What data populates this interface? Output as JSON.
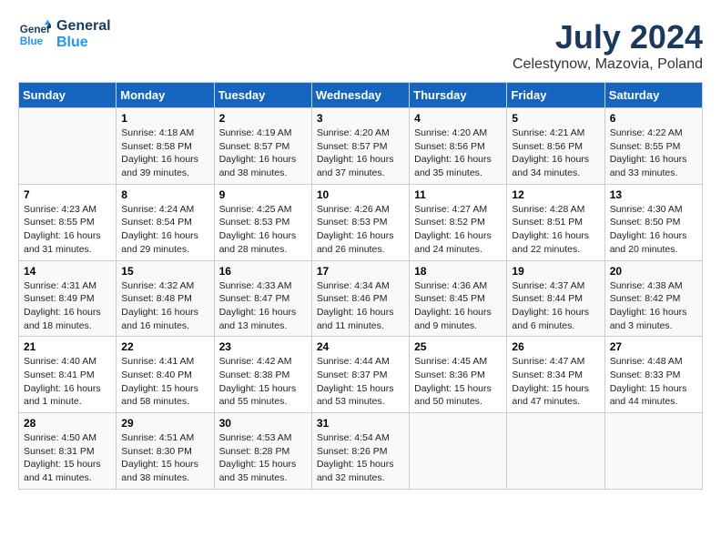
{
  "logo": {
    "line1": "General",
    "line2": "Blue"
  },
  "title": "July 2024",
  "subtitle": "Celestynow, Mazovia, Poland",
  "days_header": [
    "Sunday",
    "Monday",
    "Tuesday",
    "Wednesday",
    "Thursday",
    "Friday",
    "Saturday"
  ],
  "weeks": [
    [
      {
        "day": "",
        "info": ""
      },
      {
        "day": "1",
        "info": "Sunrise: 4:18 AM\nSunset: 8:58 PM\nDaylight: 16 hours\nand 39 minutes."
      },
      {
        "day": "2",
        "info": "Sunrise: 4:19 AM\nSunset: 8:57 PM\nDaylight: 16 hours\nand 38 minutes."
      },
      {
        "day": "3",
        "info": "Sunrise: 4:20 AM\nSunset: 8:57 PM\nDaylight: 16 hours\nand 37 minutes."
      },
      {
        "day": "4",
        "info": "Sunrise: 4:20 AM\nSunset: 8:56 PM\nDaylight: 16 hours\nand 35 minutes."
      },
      {
        "day": "5",
        "info": "Sunrise: 4:21 AM\nSunset: 8:56 PM\nDaylight: 16 hours\nand 34 minutes."
      },
      {
        "day": "6",
        "info": "Sunrise: 4:22 AM\nSunset: 8:55 PM\nDaylight: 16 hours\nand 33 minutes."
      }
    ],
    [
      {
        "day": "7",
        "info": "Sunrise: 4:23 AM\nSunset: 8:55 PM\nDaylight: 16 hours\nand 31 minutes."
      },
      {
        "day": "8",
        "info": "Sunrise: 4:24 AM\nSunset: 8:54 PM\nDaylight: 16 hours\nand 29 minutes."
      },
      {
        "day": "9",
        "info": "Sunrise: 4:25 AM\nSunset: 8:53 PM\nDaylight: 16 hours\nand 28 minutes."
      },
      {
        "day": "10",
        "info": "Sunrise: 4:26 AM\nSunset: 8:53 PM\nDaylight: 16 hours\nand 26 minutes."
      },
      {
        "day": "11",
        "info": "Sunrise: 4:27 AM\nSunset: 8:52 PM\nDaylight: 16 hours\nand 24 minutes."
      },
      {
        "day": "12",
        "info": "Sunrise: 4:28 AM\nSunset: 8:51 PM\nDaylight: 16 hours\nand 22 minutes."
      },
      {
        "day": "13",
        "info": "Sunrise: 4:30 AM\nSunset: 8:50 PM\nDaylight: 16 hours\nand 20 minutes."
      }
    ],
    [
      {
        "day": "14",
        "info": "Sunrise: 4:31 AM\nSunset: 8:49 PM\nDaylight: 16 hours\nand 18 minutes."
      },
      {
        "day": "15",
        "info": "Sunrise: 4:32 AM\nSunset: 8:48 PM\nDaylight: 16 hours\nand 16 minutes."
      },
      {
        "day": "16",
        "info": "Sunrise: 4:33 AM\nSunset: 8:47 PM\nDaylight: 16 hours\nand 13 minutes."
      },
      {
        "day": "17",
        "info": "Sunrise: 4:34 AM\nSunset: 8:46 PM\nDaylight: 16 hours\nand 11 minutes."
      },
      {
        "day": "18",
        "info": "Sunrise: 4:36 AM\nSunset: 8:45 PM\nDaylight: 16 hours\nand 9 minutes."
      },
      {
        "day": "19",
        "info": "Sunrise: 4:37 AM\nSunset: 8:44 PM\nDaylight: 16 hours\nand 6 minutes."
      },
      {
        "day": "20",
        "info": "Sunrise: 4:38 AM\nSunset: 8:42 PM\nDaylight: 16 hours\nand 3 minutes."
      }
    ],
    [
      {
        "day": "21",
        "info": "Sunrise: 4:40 AM\nSunset: 8:41 PM\nDaylight: 16 hours\nand 1 minute."
      },
      {
        "day": "22",
        "info": "Sunrise: 4:41 AM\nSunset: 8:40 PM\nDaylight: 15 hours\nand 58 minutes."
      },
      {
        "day": "23",
        "info": "Sunrise: 4:42 AM\nSunset: 8:38 PM\nDaylight: 15 hours\nand 55 minutes."
      },
      {
        "day": "24",
        "info": "Sunrise: 4:44 AM\nSunset: 8:37 PM\nDaylight: 15 hours\nand 53 minutes."
      },
      {
        "day": "25",
        "info": "Sunrise: 4:45 AM\nSunset: 8:36 PM\nDaylight: 15 hours\nand 50 minutes."
      },
      {
        "day": "26",
        "info": "Sunrise: 4:47 AM\nSunset: 8:34 PM\nDaylight: 15 hours\nand 47 minutes."
      },
      {
        "day": "27",
        "info": "Sunrise: 4:48 AM\nSunset: 8:33 PM\nDaylight: 15 hours\nand 44 minutes."
      }
    ],
    [
      {
        "day": "28",
        "info": "Sunrise: 4:50 AM\nSunset: 8:31 PM\nDaylight: 15 hours\nand 41 minutes."
      },
      {
        "day": "29",
        "info": "Sunrise: 4:51 AM\nSunset: 8:30 PM\nDaylight: 15 hours\nand 38 minutes."
      },
      {
        "day": "30",
        "info": "Sunrise: 4:53 AM\nSunset: 8:28 PM\nDaylight: 15 hours\nand 35 minutes."
      },
      {
        "day": "31",
        "info": "Sunrise: 4:54 AM\nSunset: 8:26 PM\nDaylight: 15 hours\nand 32 minutes."
      },
      {
        "day": "",
        "info": ""
      },
      {
        "day": "",
        "info": ""
      },
      {
        "day": "",
        "info": ""
      }
    ]
  ]
}
